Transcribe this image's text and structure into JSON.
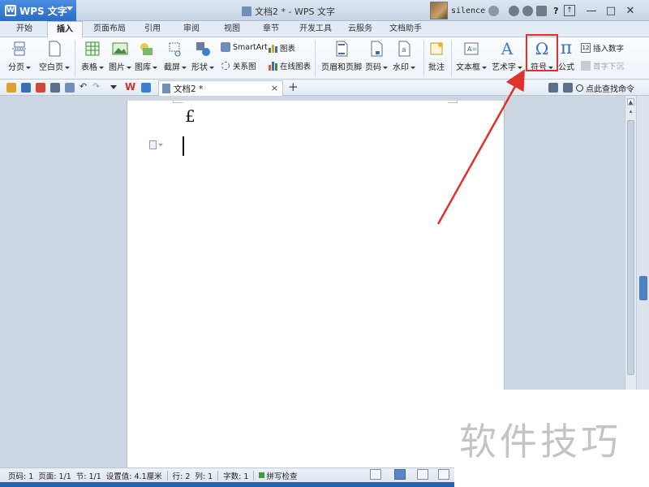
{
  "titlebar": {
    "app_name": "WPS 文字",
    "doc_title": "文档2 * - WPS 文字",
    "username": "silence",
    "help_label": "?"
  },
  "tabs": [
    "开始",
    "插入",
    "页面布局",
    "引用",
    "审阅",
    "视图",
    "章节",
    "开发工具",
    "云服务",
    "文档助手"
  ],
  "active_tab": "插入",
  "ribbon": {
    "page_break": "分页",
    "blank_page": "空白页",
    "table": "表格",
    "picture": "图片",
    "gallery": "图库",
    "screenshot": "截屏",
    "shape": "形状",
    "smartart": "SmartArt",
    "chart": "图表",
    "relation": "关系图",
    "online_chart": "在线图表",
    "header_footer": "页眉和页脚",
    "page_number": "页码",
    "watermark": "水印",
    "comment": "批注",
    "textbox": "文本框",
    "wordart": "艺术字",
    "symbol": "符号",
    "formula": "公式",
    "insert_number": "插入数字",
    "drop_cap": "首字下沉",
    "pi_glyph": "π",
    "omega_glyph": "Ω",
    "wordart_glyph": "A"
  },
  "docbar": {
    "doc_tab_label": "文档2 *",
    "close_glyph": "×",
    "new_tab_glyph": "+",
    "find_command": "点此查找命令"
  },
  "document": {
    "symbol_char": "£"
  },
  "statusbar": {
    "page": "页码: 1",
    "pages": "页面: 1/1",
    "section": "节: 1/1",
    "position": "设置值: 4.1厘米",
    "row": "行: 2",
    "col": "列: 1",
    "words": "字数: 1",
    "spell_check": "拼写检查"
  },
  "watermark_text": "软件技巧",
  "colors": {
    "accent": "#2c6cc4",
    "highlight": "#e0312a"
  }
}
